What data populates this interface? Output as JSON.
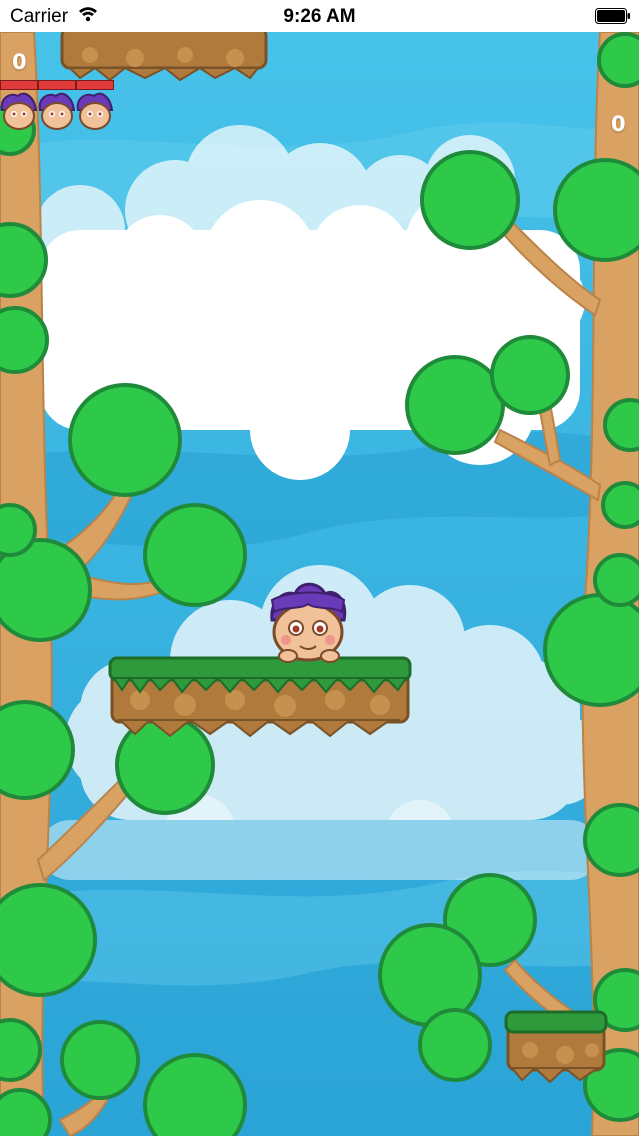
{
  "status_bar": {
    "carrier": "Carrier",
    "time": "9:26 AM"
  },
  "hud": {
    "score_left": "0",
    "score_right": "0",
    "lives_count": 3,
    "health_segments": 3
  },
  "colors": {
    "sky": "#3fb3de",
    "cloud": "#ffffff",
    "leaf": "#2fc94a",
    "leaf_outline": "#1f8a3a",
    "trunk": "#d9a162",
    "grass": "#2e9a3c",
    "dirt": "#b07a3c",
    "hair": "#6a3bb8",
    "health": "#e23b3b"
  },
  "icons": {
    "wifi": "wifi-icon",
    "battery": "battery-icon",
    "life": "monkey-head-icon"
  }
}
